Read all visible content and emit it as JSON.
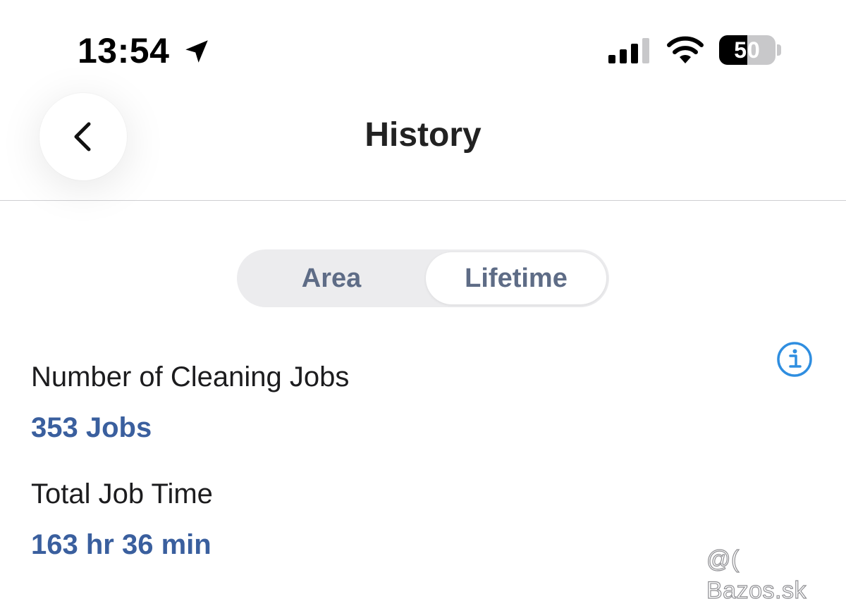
{
  "status_bar": {
    "time": "13:54",
    "battery_level": 50,
    "battery_text": "50",
    "icons": {
      "location": "location-arrow-icon",
      "signal": "cellular-signal-icon",
      "wifi": "wifi-icon",
      "battery": "battery-icon"
    }
  },
  "nav": {
    "title": "History",
    "back_icon": "chevron-left-icon"
  },
  "tabs": {
    "items": [
      {
        "label": "Area",
        "selected": false
      },
      {
        "label": "Lifetime",
        "selected": true
      }
    ]
  },
  "stats": {
    "info_icon": "info-circle-icon",
    "jobs_label": "Number of Cleaning Jobs",
    "jobs_value": "353 Jobs",
    "time_label": "Total Job Time",
    "time_value": "163 hr 36 min"
  },
  "watermark": "@( Bazos.sk",
  "colors": {
    "accent": "#3a5f9e",
    "info_blue": "#2f8ee0",
    "segment_text": "#5e6c86",
    "segment_track": "#ececee"
  }
}
